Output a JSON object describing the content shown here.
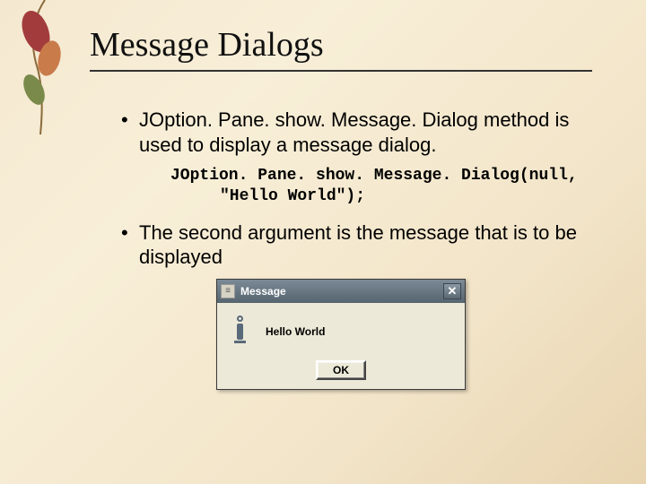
{
  "slide": {
    "title": "Message Dialogs",
    "bullet1": "JOption. Pane. show. Message. Dialog method is used to display a message dialog.",
    "code_line1": "JOption. Pane. show. Message. Dialog(null,",
    "code_line2": "\"Hello World\");",
    "bullet2": "The second argument is the message that is to be  displayed"
  },
  "dialog": {
    "title": "Message",
    "message": "Hello World",
    "ok_label": "OK",
    "close_glyph": "✕"
  }
}
